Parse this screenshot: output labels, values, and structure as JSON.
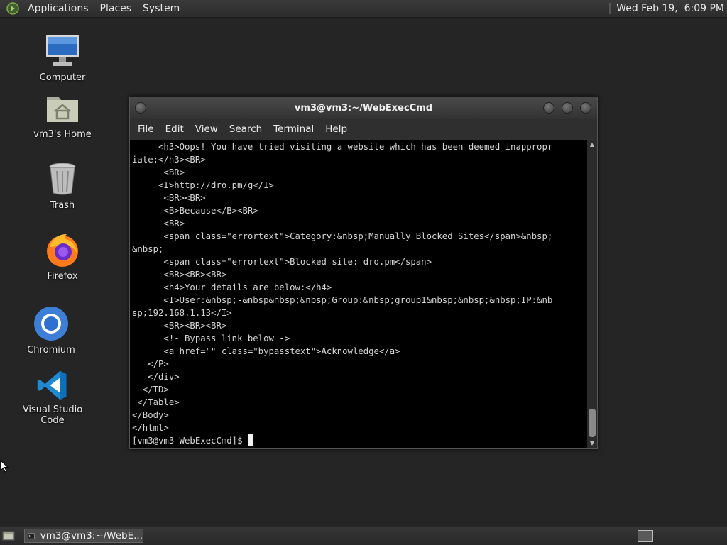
{
  "top_panel": {
    "menus": [
      "Applications",
      "Places",
      "System"
    ],
    "clock": "Wed Feb 19,  6:09 PM"
  },
  "desktop": {
    "icons": [
      {
        "label": "Computer",
        "icon": "computer-icon"
      },
      {
        "label": "vm3's Home",
        "icon": "home-folder-icon"
      },
      {
        "label": "Trash",
        "icon": "trash-icon"
      },
      {
        "label": "Firefox",
        "icon": "firefox-icon"
      },
      {
        "label": "Chromium",
        "icon": "chromium-icon"
      },
      {
        "label": "Visual Studio Code",
        "icon": "vscode-icon"
      }
    ]
  },
  "terminal": {
    "title": "vm3@vm3:~/WebExecCmd",
    "menu": [
      "File",
      "Edit",
      "View",
      "Search",
      "Terminal",
      "Help"
    ],
    "lines": [
      "     <h3>Oops! You have tried visiting a website which has been deemed inappropr",
      "iate:</h3><BR>",
      "      <BR>",
      "     <I>http://dro.pm/g</I>",
      "      <BR><BR>",
      "      <B>Because</B><BR>",
      "      <BR>",
      "      <span class=\"errortext\">Category:&nbsp;Manually Blocked Sites</span>&nbsp;",
      "&nbsp;",
      "      <span class=\"errortext\">Blocked site: dro.pm</span>",
      "      <BR><BR><BR>",
      "      <h4>Your details are below:</h4>",
      "      <I>User:&nbsp;-&nbsp&nbsp;&nbsp;Group:&nbsp;group1&nbsp;&nbsp;&nbsp;IP:&nb",
      "sp;192.168.1.13</I>",
      "      <BR><BR><BR>",
      "      <!- Bypass link below ->",
      "      <a href=\"\" class=\"bypasstext\">Acknowledge</a>",
      "   </P>",
      "   </div>",
      "  </TD>",
      " </Table>",
      "</Body>",
      "</html>"
    ],
    "prompt": "[vm3@vm3 WebExecCmd]$ "
  },
  "taskbar": {
    "task_label": "vm3@vm3:~/WebE..."
  },
  "colors": {
    "desktop_bg": "#252525",
    "terminal_bg": "#000000",
    "terminal_fg": "#d6d6d6"
  }
}
